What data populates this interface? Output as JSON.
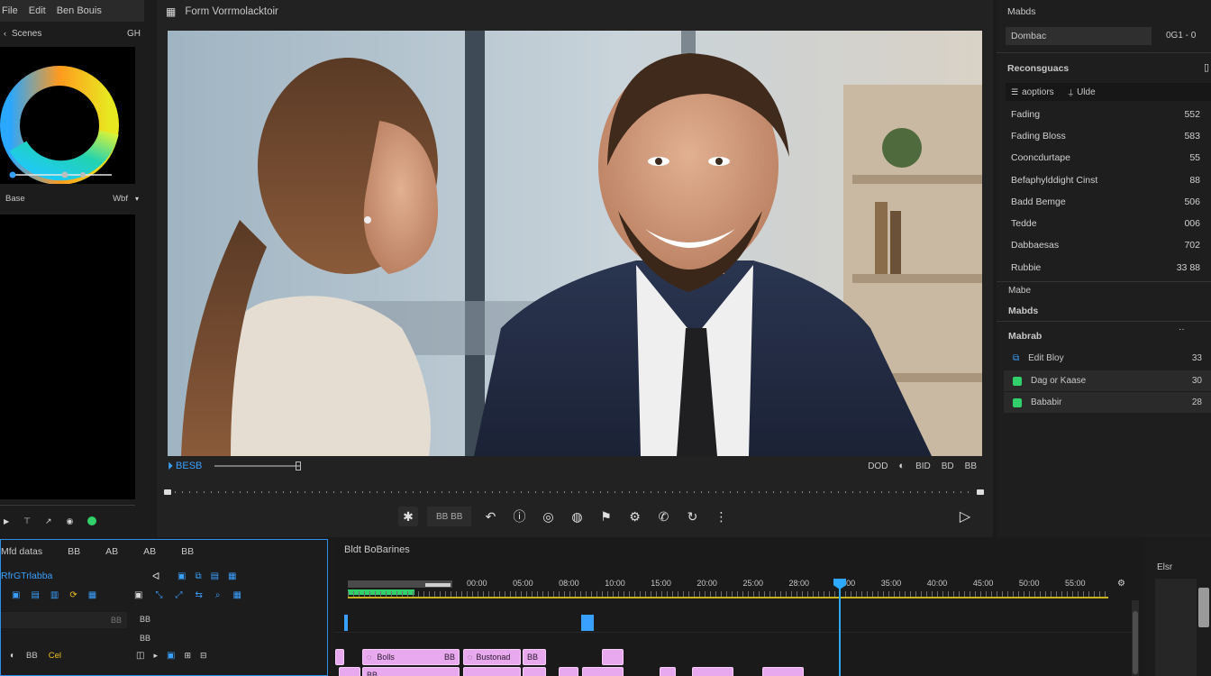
{
  "menu": {
    "items": [
      "File",
      "Edit",
      "Ben Bouis"
    ]
  },
  "color_panel": {
    "header_left": "Scenes",
    "header_right": "GH",
    "footer_left": "Base",
    "footer_right": "Wbf"
  },
  "viewer": {
    "title": "Form Vorrmolacktoir",
    "timecode_left": "BESB",
    "readout_1": "DOD",
    "readout_2": "BID",
    "readout_3": "BD",
    "readout_4": "BB",
    "toolbar_label": "BB BB"
  },
  "right_panel": {
    "header": "Mabds",
    "field_value": "Dombac",
    "field_right": "0G1 - 0",
    "section_title": "Reconsguacs",
    "tab_1": "aoptiors",
    "tab_2": "Ulde",
    "props": [
      {
        "label": "Fading",
        "value": "552"
      },
      {
        "label": "Fading Bloss",
        "value": "583"
      },
      {
        "label": "Cooncdurtape",
        "value": "55"
      },
      {
        "label": "Befaphylddight Cinst",
        "value": "88"
      },
      {
        "label": "Badd Bemge",
        "value": "506"
      },
      {
        "label": "Tedde",
        "value": "006"
      },
      {
        "label": "Dabbaesas",
        "value": "702"
      },
      {
        "label": "Rubbie",
        "value": "33 88"
      }
    ],
    "section_2a": "Mabe",
    "section_2b": "Mabds",
    "section_3": "Mabrab",
    "effects": [
      {
        "label": "Edit Bloy",
        "value": "33"
      },
      {
        "label": "Dag or Kaase",
        "value": "30"
      },
      {
        "label": "Bababir",
        "value": "28"
      }
    ],
    "far_right_label": "Elsr"
  },
  "media_panel": {
    "tabs": [
      "Mfd datas",
      "BB",
      "AB",
      "AB",
      "BB"
    ],
    "subtitle": "RfrGTrlabba",
    "rows": [
      {
        "a": "",
        "b": "BB"
      },
      {
        "a": "BB",
        "b": "Cel"
      }
    ],
    "tc_a": "BB",
    "tc_b": "BB"
  },
  "timeline": {
    "title": "Bldt BoBarines",
    "ruler_marks": [
      "00:00",
      "05:00",
      "08:00",
      "10:00",
      "15:00",
      "20:00",
      "25:00",
      "28:00",
      "30:00",
      "35:00",
      "40:00",
      "45:00",
      "50:00",
      "55:00"
    ],
    "clip_labels": [
      "Bolls",
      "BB",
      "Bustonad",
      "BB",
      "BB"
    ]
  },
  "colors": {
    "accent": "#3aa0ff",
    "clip_pink": "#e9a9ee",
    "playhead": "#2ea8ff",
    "green": "#31d06a"
  }
}
